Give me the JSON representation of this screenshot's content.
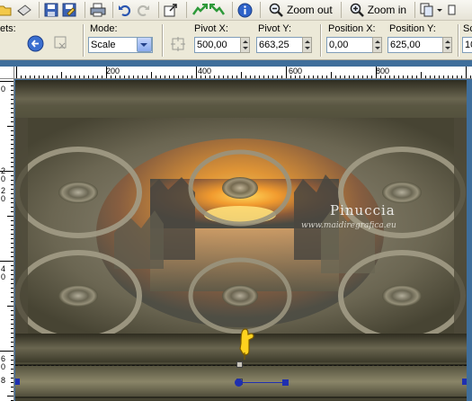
{
  "toolbar": {
    "zoom_out_label": "Zoom out",
    "zoom_in_label": "Zoom in"
  },
  "tool_options": {
    "presets_label": "ets:",
    "mode_label": "Mode:",
    "mode_value": "Scale",
    "pivot_x_label": "Pivot X:",
    "pivot_x_value": "500,00",
    "pivot_y_label": "Pivot Y:",
    "pivot_y_value": "663,25",
    "position_x_label": "Position X:",
    "position_x_value": "0,00",
    "position_y_label": "Position Y:",
    "position_y_value": "625,00",
    "scale_label": "Sc",
    "scale_value": "10"
  },
  "rulers": {
    "h_labels": [
      "200",
      "400",
      "600",
      "800"
    ],
    "v_labels": [
      "0",
      "2",
      "0",
      "2",
      "0",
      "4",
      "0",
      "6",
      "0",
      "8"
    ]
  },
  "watermark": {
    "name": "Pinuccia",
    "url": "www.maidiregrafica.eu"
  },
  "colors": {
    "workspace": "#3f6e9b",
    "toolbar": "#ece9d8",
    "frame": "#57553f",
    "sunset": "#f19a2e"
  }
}
